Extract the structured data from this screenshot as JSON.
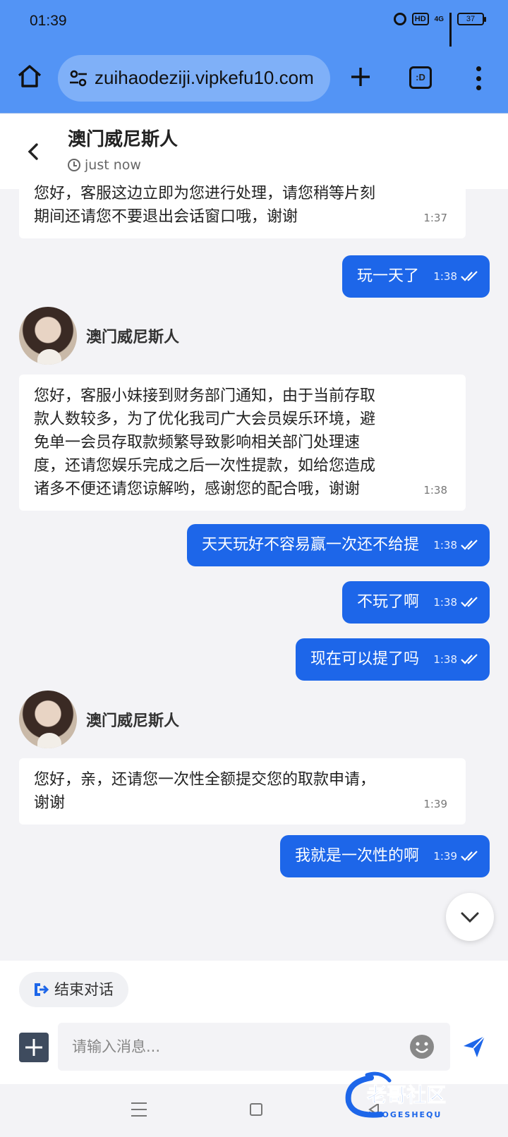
{
  "status_bar": {
    "time": "01:39",
    "hd_label": "HD",
    "network_label": "4G",
    "battery": "37"
  },
  "browser": {
    "url": "zuihaodeziji.vipkefu10.com",
    "tabs_label": ":D"
  },
  "chat": {
    "title": "澳门威尼斯人",
    "subtitle": "just now"
  },
  "messages": [
    {
      "direction": "in",
      "lines": [
        "您好，客服这边立即为您进行处理，请您稍等片刻",
        "期间还请您不要退出会话窗口哦，谢谢"
      ],
      "time": "1:37"
    },
    {
      "direction": "out",
      "text": "玩一天了",
      "time": "1:38"
    },
    {
      "direction": "sender",
      "name": "澳门威尼斯人"
    },
    {
      "direction": "in",
      "lines": [
        "您好，客服小妹接到财务部门通知，由于当前存取",
        "款人数较多，为了优化我司广大会员娱乐环境，避",
        "免单一会员存取款频繁导致影响相关部门处理速",
        "度，还请您娱乐完成之后一次性提款，如给您造成",
        "诸多不便还请您谅解哟，感谢您的配合哦，谢谢"
      ],
      "time": "1:38"
    },
    {
      "direction": "out",
      "text": "天天玩好不容易赢一次还不给提",
      "time": "1:38"
    },
    {
      "direction": "out",
      "text": "不玩了啊",
      "time": "1:38"
    },
    {
      "direction": "out",
      "text": "现在可以提了吗",
      "time": "1:38"
    },
    {
      "direction": "sender",
      "name": "澳门威尼斯人"
    },
    {
      "direction": "in",
      "lines": [
        "您好，亲，还请您一次性全额提交您的取款申请，",
        "谢谢"
      ],
      "time": "1:39"
    },
    {
      "direction": "out",
      "text": "我就是一次性的啊",
      "time": "1:39"
    }
  ],
  "composer": {
    "end_chat_label": "结束对话",
    "placeholder": "请输入消息..."
  },
  "watermark": {
    "title": "老哥社区",
    "subtitle": "LAOGESHEQU"
  },
  "colors": {
    "browser_bar": "#5394f5",
    "out_bubble": "#1d66e9",
    "background": "#f3f3f6"
  }
}
